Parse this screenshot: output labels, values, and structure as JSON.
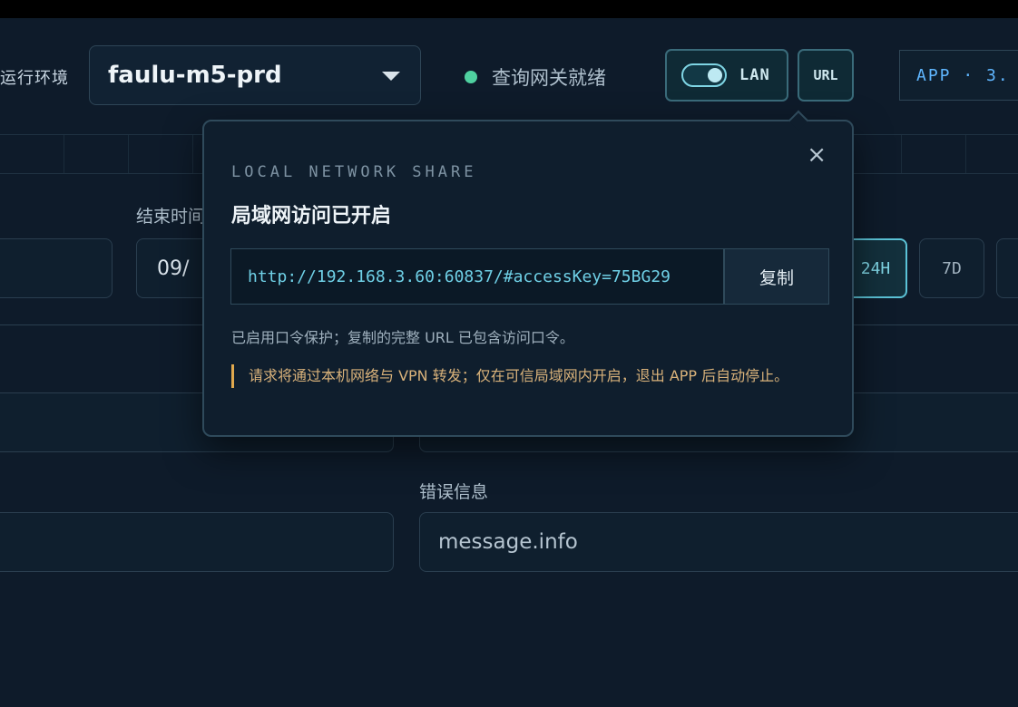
{
  "header": {
    "env_label": "运行环境",
    "env_value": "faulu-m5-prd",
    "gateway_status": "查询网关就绪",
    "lan_label": "LAN",
    "url_label": "URL",
    "app_version": "APP · 3."
  },
  "form": {
    "end_time_label": "结束时间",
    "end_time_value": "09/",
    "range_24h": "24H",
    "range_7d": "7D",
    "error_label": "错误信息",
    "error_value": "message.info"
  },
  "popover": {
    "eyebrow": "LOCAL NETWORK SHARE",
    "title": "局域网访问已开启",
    "url": "http://192.168.3.60:60837/#accessKey=75BG29",
    "copy_label": "复制",
    "note": "已启用口令保护；复制的完整 URL 已包含访问口令。",
    "warning": "请求将通过本机网络与 VPN 转发；仅在可信局域网内开启，退出 APP 后自动停止。",
    "close_glyph": "×"
  },
  "colors": {
    "background": "#0e1b2a",
    "accent": "#6fd0e6",
    "status_ok": "#4fd1a0",
    "warning": "#e0a94e"
  }
}
